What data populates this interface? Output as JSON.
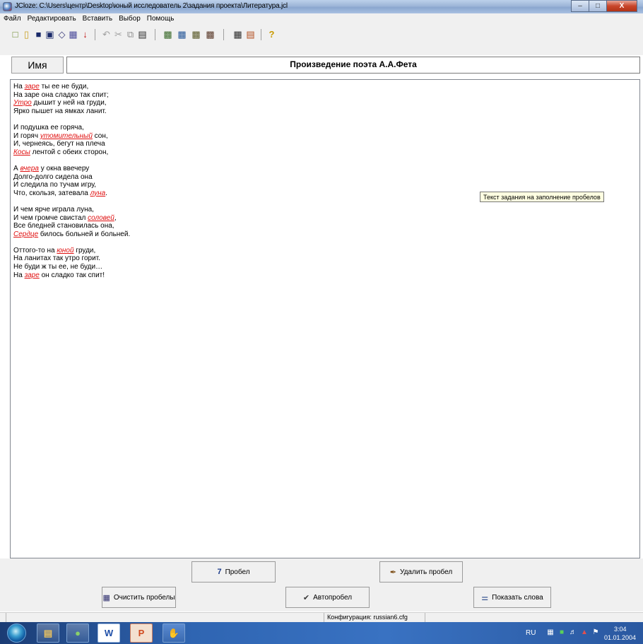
{
  "window": {
    "title": "JCloze: C:\\Users\\центр\\Desktop\\юный исследователь 2\\задания проекта\\Литература.jcl",
    "min_label": "–",
    "max_label": "□",
    "close_label": "X"
  },
  "menu": {
    "items": [
      "Файл",
      "Редактировать",
      "Вставить",
      "Выбор",
      "Помощь"
    ]
  },
  "toolbar": {
    "icons": [
      "new-icon",
      "open-icon",
      "save-icon",
      "save-as-icon",
      "clear-icon",
      "export-icon",
      "down-arrow-icon",
      "undo-icon",
      "cut-icon",
      "copy-icon",
      "paste-icon",
      "gap-tool-1-icon",
      "gap-tool-2-icon",
      "gap-tool-3-icon",
      "gap-tool-4-icon",
      "config-icon",
      "output-icon",
      "help-icon"
    ]
  },
  "name_button_label": "Имя",
  "exercise_title": "Произведение поэта А.А.Фета",
  "poem": [
    [
      [
        "На ",
        false
      ],
      [
        "заре",
        true
      ],
      [
        " ты ее не буди,",
        false
      ]
    ],
    [
      [
        "На заре она сладко так спит;",
        false
      ]
    ],
    [
      [
        "Утро",
        true
      ],
      [
        " дышит у ней на груди,",
        false
      ]
    ],
    [
      [
        "Ярко пышет на ямках ланит.",
        false
      ]
    ],
    [],
    [
      [
        "И подушка ее горяча,",
        false
      ]
    ],
    [
      [
        "И горяч ",
        false
      ],
      [
        "утомительный",
        true
      ],
      [
        " сон,",
        false
      ]
    ],
    [
      [
        "И, чернеясь, бегут на плеча",
        false
      ]
    ],
    [
      [
        "Косы",
        true
      ],
      [
        " лентой с обеих сторон,",
        false
      ]
    ],
    [],
    [
      [
        "А ",
        false
      ],
      [
        "вчера",
        true
      ],
      [
        " у окна ввечеру",
        false
      ]
    ],
    [
      [
        "Долго-долго сидела она",
        false
      ]
    ],
    [
      [
        "И следила по тучам игру,",
        false
      ]
    ],
    [
      [
        "Что, скользя, затевала ",
        false
      ],
      [
        "луна",
        true
      ],
      [
        ".",
        false
      ]
    ],
    [],
    [
      [
        "И чем ярче играла луна,",
        false
      ]
    ],
    [
      [
        "И чем громче свистал ",
        false
      ],
      [
        "соловей",
        true
      ],
      [
        ",",
        false
      ]
    ],
    [
      [
        "Все бледней становилась она,",
        false
      ]
    ],
    [
      [
        "Сердце",
        true
      ],
      [
        " билось больней и больней.",
        false
      ]
    ],
    [],
    [
      [
        "Оттого-то на ",
        false
      ],
      [
        "юной",
        true
      ],
      [
        " груди,",
        false
      ]
    ],
    [
      [
        "На ланитах так утро горит.",
        false
      ]
    ],
    [
      [
        "Не буди  ж ты ее, не буди…",
        false
      ]
    ],
    [
      [
        "На ",
        false
      ],
      [
        "заре",
        true
      ],
      [
        " он сладко так спит!",
        false
      ]
    ]
  ],
  "tooltip": "Текст задания на заполнение пробелов",
  "buttons": {
    "gap": "Пробел",
    "delete_gap": "Удалить пробел",
    "clear_gaps": "Очистить пробелы",
    "auto_gap": "Автопробел",
    "show_words": "Показать слова"
  },
  "status": {
    "config": "Конфигурация: russian6.cfg"
  },
  "taskbar": {
    "tasks": [
      "explorer-icon",
      "people-icon",
      "word-icon",
      "powerpoint-icon",
      "hotpotatoes-icon"
    ],
    "word_label": "W",
    "ppt_label": "P",
    "lang": "RU",
    "time": "3:04",
    "date": "01.01.2004"
  }
}
